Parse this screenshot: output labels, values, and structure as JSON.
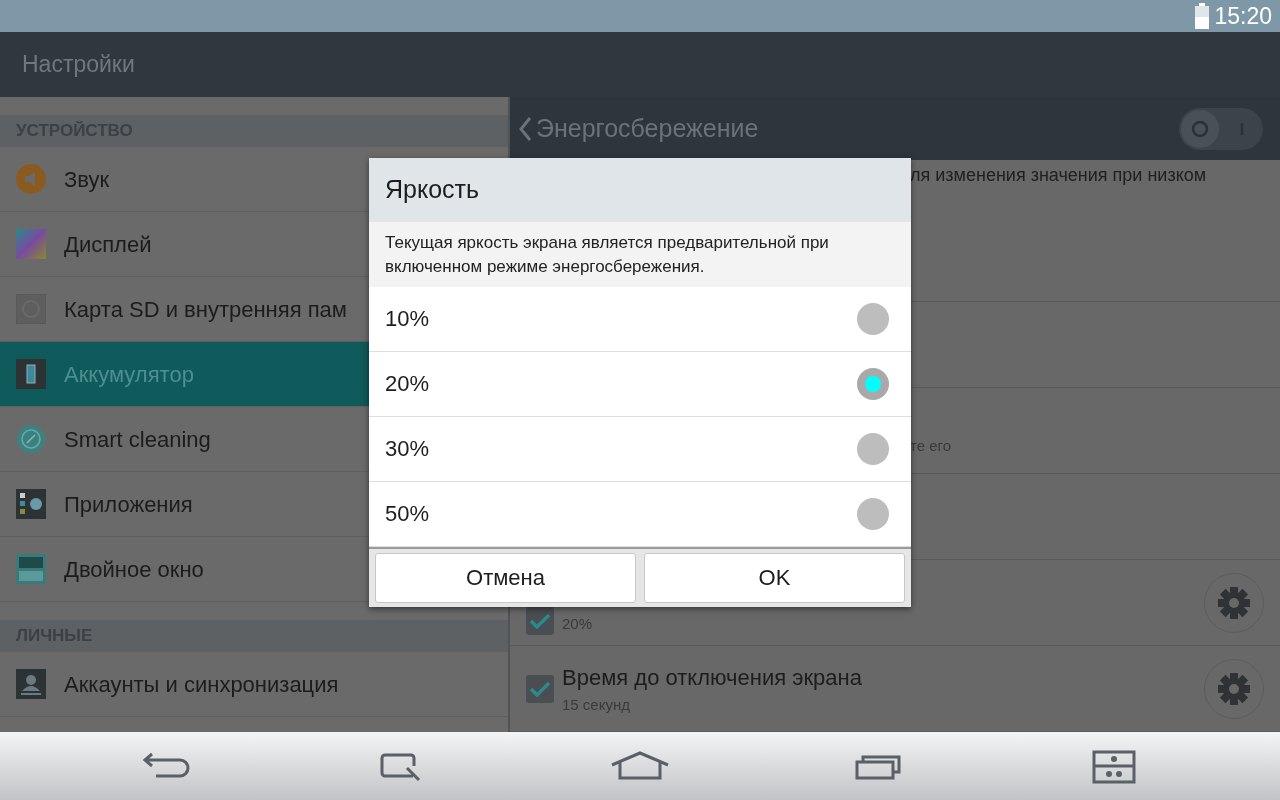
{
  "status_bar": {
    "time": "15:20"
  },
  "action_bar": {
    "title": "Настройки"
  },
  "sidebar": {
    "sections": [
      {
        "header": "УСТРОЙСТВО",
        "items": [
          {
            "label": "Звук",
            "selected": false
          },
          {
            "label": "Дисплей",
            "selected": false
          },
          {
            "label": "Карта SD и внутренняя пам",
            "selected": false
          },
          {
            "label": "Аккумулятор",
            "selected": true
          },
          {
            "label": "Smart cleaning",
            "selected": false
          },
          {
            "label": "Приложения",
            "selected": false
          },
          {
            "label": "Двойное окно",
            "selected": false
          }
        ]
      },
      {
        "header": "ЛИЧНЫЕ",
        "items": [
          {
            "label": "Аккаунты и синхронизация",
            "selected": false
          }
        ]
      }
    ]
  },
  "detail": {
    "title": "Энергосбережение",
    "switch": {
      "on": false
    },
    "rows": [
      {
        "kind": "fragment",
        "text": "ля изменения значения при низком"
      },
      {
        "kind": "empty"
      },
      {
        "kind": "fragment",
        "text": "те его"
      },
      {
        "kind": "empty"
      },
      {
        "kind": "setting",
        "checked": true,
        "subtitle": "20%"
      },
      {
        "kind": "setting",
        "checked": true,
        "title": "Время до отключения экрана",
        "subtitle": "15 секунд"
      }
    ]
  },
  "dialog": {
    "title": "Яркость",
    "message": "Текущая яркость экрана является предварительной при включенном режиме энергосбережения.",
    "options": [
      {
        "label": "10%",
        "selected": false
      },
      {
        "label": "20%",
        "selected": true
      },
      {
        "label": "30%",
        "selected": false
      },
      {
        "label": "50%",
        "selected": false
      }
    ],
    "buttons": [
      "Отмена",
      "OK"
    ]
  }
}
